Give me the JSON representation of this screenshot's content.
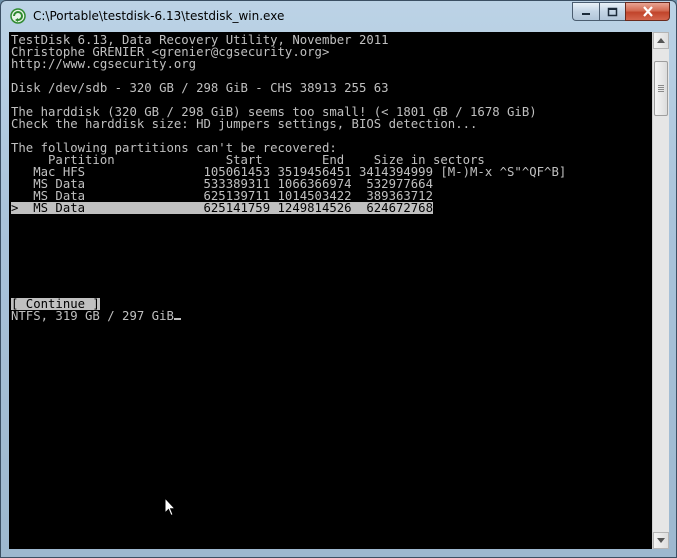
{
  "window": {
    "title": "C:\\Portable\\testdisk-6.13\\testdisk_win.exe"
  },
  "console": {
    "lines": [
      "TestDisk 6.13, Data Recovery Utility, November 2011",
      "Christophe GRENIER <grenier@cgsecurity.org>",
      "http://www.cgsecurity.org",
      "",
      "Disk /dev/sdb - 320 GB / 298 GiB - CHS 38913 255 63",
      "",
      "The harddisk (320 GB / 298 GiB) seems too small! (< 1801 GB / 1678 GiB)",
      "Check the harddisk size: HD jumpers settings, BIOS detection...",
      "",
      "The following partitions can't be recovered:",
      "     Partition               Start        End    Size in sectors",
      "   Mac HFS                105061453 3519456451 3414394999 [M-)M-x ^S\"^QF^B]",
      "   MS Data                533389311 1066366974  532977664",
      "   MS Data                625139711 1014503422  389363712",
      ">  MS Data                625141759 1249814526  624672768"
    ],
    "continue_button": "[ Continue ]",
    "status": "NTFS, 319 GB / 297 GiB"
  },
  "icons": {
    "app": "testdisk-app-icon",
    "minimize": "minimize-icon",
    "maximize": "maximize-icon",
    "close": "close-icon",
    "scroll_up": "scroll-up-arrow-icon",
    "scroll_down": "scroll-down-arrow-icon",
    "mouse": "mouse-pointer-icon"
  }
}
